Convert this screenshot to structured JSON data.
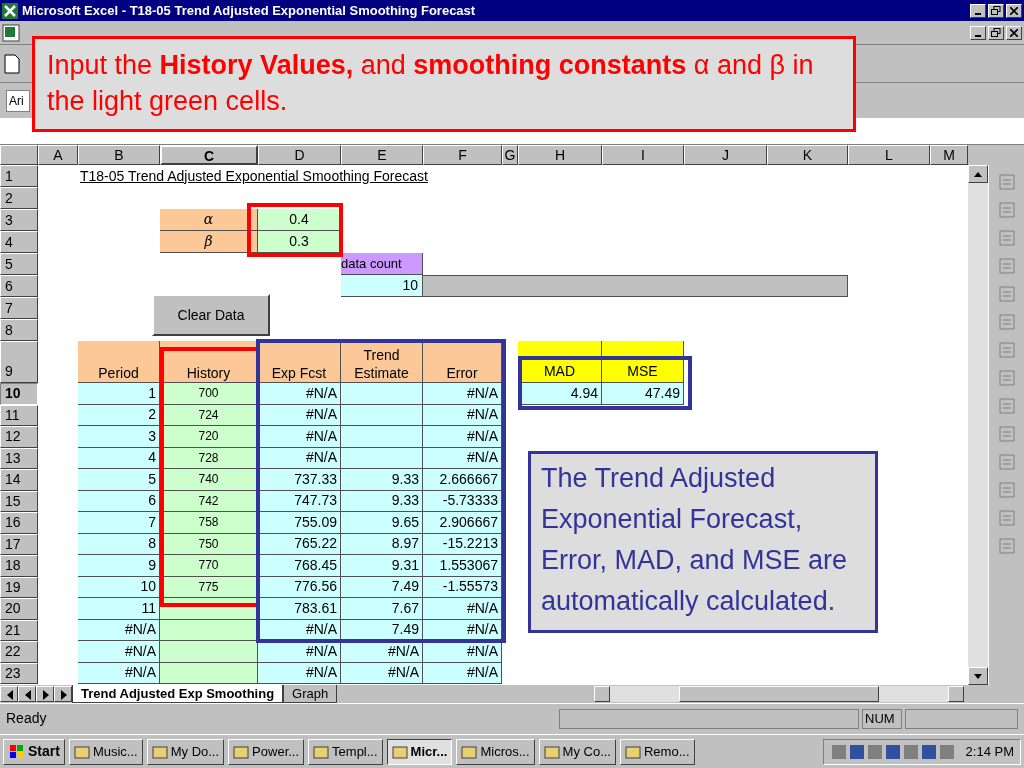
{
  "window": {
    "title": "Microsoft Excel - T18-05 Trend Adjusted Exponential Smoothing Forecast"
  },
  "toolbar": {
    "font_field": "Ari"
  },
  "callouts": [
    {
      "kind": "red",
      "text": "Input the **History Values,** and **smoothing constants** α and β in the light green cells."
    },
    {
      "kind": "blue",
      "text": "The Trend Adjusted Exponential Forecast, Error, MAD, and MSE are automatically calculated."
    }
  ],
  "sheet": {
    "columns": [
      {
        "label": "A",
        "selected": false
      },
      {
        "label": "B",
        "selected": false
      },
      {
        "label": "C",
        "selected": true
      },
      {
        "label": "D",
        "selected": false
      },
      {
        "label": "E",
        "selected": false
      },
      {
        "label": "F",
        "selected": false
      },
      {
        "label": "G",
        "selected": false
      },
      {
        "label": "H",
        "selected": false
      },
      {
        "label": "I",
        "selected": false
      },
      {
        "label": "J",
        "selected": false
      },
      {
        "label": "K",
        "selected": false
      },
      {
        "label": "L",
        "selected": false
      },
      {
        "label": "M",
        "selected": false
      }
    ],
    "rows": [
      {
        "label": "1",
        "selected": false
      },
      {
        "label": "2",
        "selected": false
      },
      {
        "label": "3",
        "selected": false
      },
      {
        "label": "4",
        "selected": false
      },
      {
        "label": "5",
        "selected": false
      },
      {
        "label": "6",
        "selected": false
      },
      {
        "label": "7",
        "selected": false
      },
      {
        "label": "8",
        "selected": false
      },
      {
        "label": "9",
        "selected": false
      },
      {
        "label": "10",
        "selected": true
      },
      {
        "label": "11",
        "selected": false
      },
      {
        "label": "12",
        "selected": false
      },
      {
        "label": "13",
        "selected": false
      },
      {
        "label": "14",
        "selected": false
      },
      {
        "label": "15",
        "selected": false
      },
      {
        "label": "16",
        "selected": false
      },
      {
        "label": "17",
        "selected": false
      },
      {
        "label": "18",
        "selected": false
      },
      {
        "label": "19",
        "selected": false
      },
      {
        "label": "20",
        "selected": false
      },
      {
        "label": "21",
        "selected": false
      },
      {
        "label": "22",
        "selected": false
      },
      {
        "label": "23",
        "selected": false
      }
    ],
    "title": "T18-05 Trend Adjusted Exponential Smoothing Forecast",
    "params": [
      {
        "label": "α",
        "value": "0.4"
      },
      {
        "label": "β",
        "value": "0.3"
      }
    ],
    "data_count": {
      "label": "data count",
      "value": "10"
    },
    "clear_button": "Clear Data",
    "table": {
      "columns": [
        "Period",
        "History",
        "Exp Fcst",
        "Trend Estimate",
        "Error"
      ],
      "rows": [
        {
          "period": "1",
          "history": "700",
          "exp_fcst": "#N/A",
          "error": "#N/A"
        },
        {
          "period": "2",
          "history": "724",
          "exp_fcst": "#N/A",
          "error": "#N/A"
        },
        {
          "period": "3",
          "history": "720",
          "exp_fcst": "#N/A",
          "error": "#N/A"
        },
        {
          "period": "4",
          "history": "728",
          "exp_fcst": "#N/A",
          "error": "#N/A"
        },
        {
          "period": "5",
          "history": "740",
          "exp_fcst": "737.33",
          "trend": "9.33",
          "error": "2.666667"
        },
        {
          "period": "6",
          "history": "742",
          "exp_fcst": "747.73",
          "trend": "9.33",
          "error": "-5.73333"
        },
        {
          "period": "7",
          "history": "758",
          "exp_fcst": "755.09",
          "trend": "9.65",
          "error": "2.906667"
        },
        {
          "period": "8",
          "history": "750",
          "exp_fcst": "765.22",
          "trend": "8.97",
          "error": "-15.2213"
        },
        {
          "period": "9",
          "history": "770",
          "exp_fcst": "768.45",
          "trend": "9.31",
          "error": "1.553067"
        },
        {
          "period": "10",
          "history": "775",
          "exp_fcst": "776.56",
          "trend": "7.49",
          "error": "-1.55573"
        },
        {
          "period": "11",
          "exp_fcst": "783.61",
          "trend": "7.67",
          "error": "#N/A"
        },
        {
          "period": "#N/A",
          "exp_fcst": "#N/A",
          "trend": "7.49",
          "error": "#N/A"
        },
        {
          "period": "#N/A",
          "exp_fcst": "#N/A",
          "trend": "#N/A",
          "error": "#N/A"
        },
        {
          "period": "#N/A",
          "exp_fcst": "#N/A",
          "trend": "#N/A",
          "error": "#N/A"
        }
      ]
    },
    "summary": {
      "columns": [
        "MAD",
        "MSE"
      ],
      "values": [
        "4.94",
        "47.49"
      ]
    }
  },
  "sheet_tabs": [
    {
      "label": "Trend Adjusted Exp Smoothing",
      "selected": true
    },
    {
      "label": "Graph",
      "selected": false
    }
  ],
  "status_bar": {
    "text": "Ready",
    "indicator": "NUM"
  },
  "taskbar": {
    "start": "Start",
    "items": [
      {
        "label": "Music...",
        "selected": false
      },
      {
        "label": "My Do...",
        "selected": false
      },
      {
        "label": "Power...",
        "selected": false
      },
      {
        "label": "Templ...",
        "selected": false
      },
      {
        "label": "Micr...",
        "selected": true
      },
      {
        "label": "Micros...",
        "selected": false
      },
      {
        "label": "My Co...",
        "selected": false
      },
      {
        "label": "Remo...",
        "selected": false
      }
    ],
    "clock": "2:14 PM"
  }
}
